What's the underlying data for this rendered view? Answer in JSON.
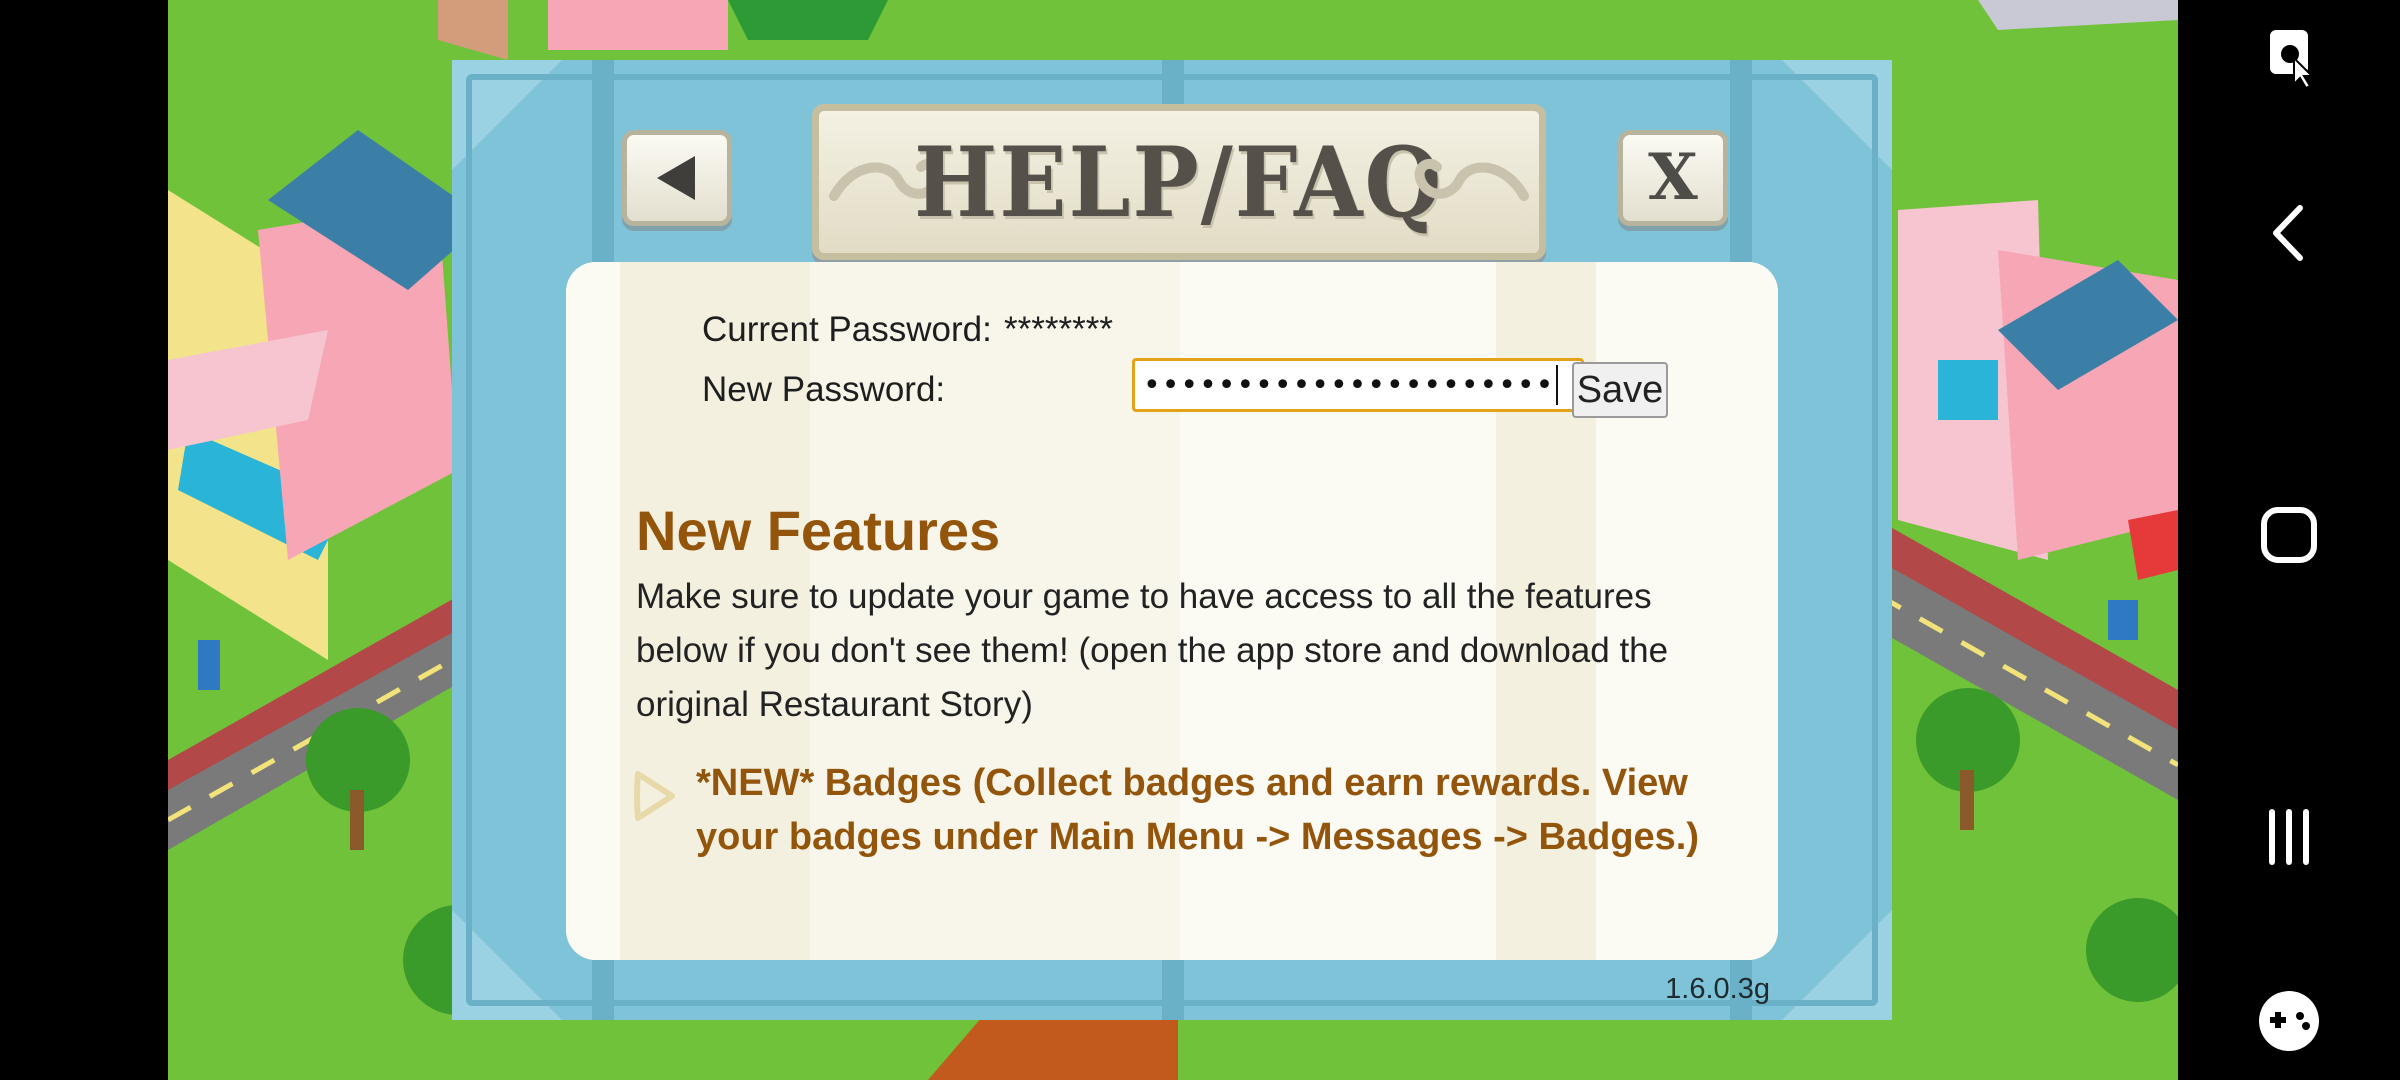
{
  "dialog": {
    "title": "HELP/FAQ",
    "back_icon": "left-triangle-icon",
    "close_label": "X",
    "version": "1.6.0.3g"
  },
  "password": {
    "current_label": "Current Password:",
    "current_value": "********",
    "new_label": "New Password:",
    "new_value": "••••••••••••••••••••••",
    "save_label": "Save"
  },
  "features": {
    "title": "New Features",
    "description": "Make sure to update your game to have access to all the features below if you don't see them! (open the app store and download the original Restaurant Story)",
    "items": [
      {
        "text": "*NEW* Badges (Collect badges and earn rewards. View your badges under Main Menu -> Messages -> Badges.)"
      }
    ]
  },
  "navbar": {
    "icons": [
      "screen-record-icon",
      "back-chevron-icon",
      "home-square-icon",
      "recents-icon",
      "game-launcher-icon"
    ]
  },
  "colors": {
    "dialog_blue": "#7fc3d8",
    "feature_brown": "#93550c",
    "input_focus": "#e3a21a",
    "grass": "#6fc23a"
  }
}
